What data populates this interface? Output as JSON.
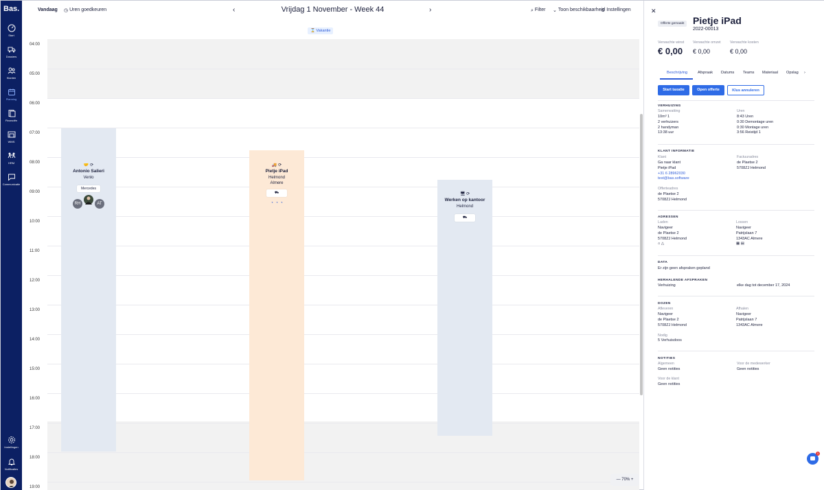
{
  "app": {
    "logo": "Bas."
  },
  "sidebar": {
    "items": [
      {
        "label": "Start",
        "icon": "dashboard-icon"
      },
      {
        "label": "Dossiers",
        "icon": "truck-icon"
      },
      {
        "label": "Klanten",
        "icon": "users-icon"
      },
      {
        "label": "Planning",
        "icon": "calendar-icon"
      },
      {
        "label": "Financiën",
        "icon": "finance-icon"
      },
      {
        "label": "WMS",
        "icon": "warehouse-icon"
      },
      {
        "label": "HRM",
        "icon": "people-icon"
      },
      {
        "label": "Communicatie",
        "icon": "chat-icon"
      }
    ],
    "bottom": [
      {
        "label": "Instellingen",
        "icon": "gear-icon"
      },
      {
        "label": "Notificaties",
        "icon": "bell-icon"
      }
    ]
  },
  "toolbar": {
    "today": "Vandaag",
    "approve_hours": "Uren goedkeuren",
    "date_title": "Vrijdag 1 November - Week 44",
    "filter": "Filter",
    "availability": "Toon beschikbaarheid",
    "settings": "Instellingen",
    "holiday_badge": "Vakantie",
    "zoom": "70%"
  },
  "calendar": {
    "hours": [
      "04:00",
      "05:00",
      "06:00",
      "07:00",
      "08:00",
      "09:00",
      "10:00",
      "11:00",
      "12:00",
      "13:00",
      "14:00",
      "15:00",
      "16:00",
      "17:00",
      "18:00",
      "19:00"
    ],
    "events": [
      {
        "title": "Antonio Salieri",
        "city": "Venlo",
        "vehicle": "Mercedes",
        "people": [
          "RH",
          "",
          "AT"
        ],
        "color": "#e3e9f2"
      },
      {
        "title": "Pietje iPad",
        "city": "Helmond",
        "city2": "Almere",
        "color": "#fde9d6"
      },
      {
        "title": "Werken op kantoor",
        "city": "Helmond",
        "color": "#e3e9f2"
      }
    ]
  },
  "detail": {
    "status_badge": "Offerte gemaakt",
    "title": "Pietje iPad",
    "number": "2022-00013",
    "metrics": [
      {
        "label": "Verwachte winst",
        "value": "€ 0,00"
      },
      {
        "label": "Verwachte omzet",
        "value": "€ 0,00"
      },
      {
        "label": "Verwachte kosten",
        "value": "€ 0,00"
      }
    ],
    "tabs": [
      "Beschrijving",
      "Afspraak",
      "Datums",
      "Teams",
      "Materiaal",
      "Opslag"
    ],
    "actions": {
      "start": "Start taxatie",
      "open": "Open offerte",
      "cancel": "Klus annuleren"
    },
    "verhuizing": {
      "heading": "VERHUIZING",
      "summary_label": "Samenvatting",
      "summary": [
        "10m³ 1",
        "2 verhuizers",
        "2 handyman",
        "13:38 uur"
      ],
      "hours_label": "Uren",
      "hours": [
        "8:43 Uren",
        "0:30 Demontage uren",
        "0:30 Montage uren",
        "3:56 Reistijd 1"
      ]
    },
    "klant": {
      "heading": "KLANT INFORMATIE",
      "client_label": "Klant",
      "client": [
        "Ga naar klant",
        "Pietje iPad",
        "+31 6 28962030",
        "test@bas.software"
      ],
      "invoice_label": "Factuuradres",
      "invoice": [
        "de Plaetse 2",
        "5708ZJ Helmond"
      ],
      "quote_label": "Offerteadres",
      "quote": [
        "de Plaetse 2",
        "5708ZJ Helmond"
      ]
    },
    "adressen": {
      "heading": "ADRESSEN",
      "load_label": "Laden",
      "load": [
        "Navigeer",
        "de Plaetse 2",
        "5708ZJ Helmond"
      ],
      "unload_label": "Lossen",
      "unload": [
        "Navigeer",
        "Patrijslaan 7",
        "1343AC Almere"
      ]
    },
    "data": {
      "heading": "DATA",
      "text": "Er zijn geen afspraken gepland"
    },
    "herhalend": {
      "heading": "HERHALENDE AFSPRAKEN",
      "type": "Verhuizing",
      "rule": "elke dag tot december 17, 2024"
    },
    "dozen": {
      "heading": "DOZEN",
      "deliver_label": "Afleveren",
      "deliver": [
        "Navigeer",
        "de Plaetse 2",
        "5708ZJ Helmond"
      ],
      "pickup_label": "Afhalen",
      "pickup": [
        "Navigeer",
        "Patrijslaan 7",
        "1343AC Almere"
      ],
      "needed_label": "Nodig",
      "needed": "5 Verhuisdoos"
    },
    "notities": {
      "heading": "NOTITIES",
      "general_label": "Algemeen",
      "general": "Geen notities",
      "employee_label": "Voor de medewerker",
      "employee": "Geen notities",
      "client_label": "Voor de klant",
      "client": "Geen notities"
    },
    "chat_badge": "1"
  },
  "colors": {
    "sidebar": "#0c2063",
    "accent": "#2e6be6",
    "event_blue": "#e3e9f2",
    "event_orange": "#fde9d6"
  }
}
